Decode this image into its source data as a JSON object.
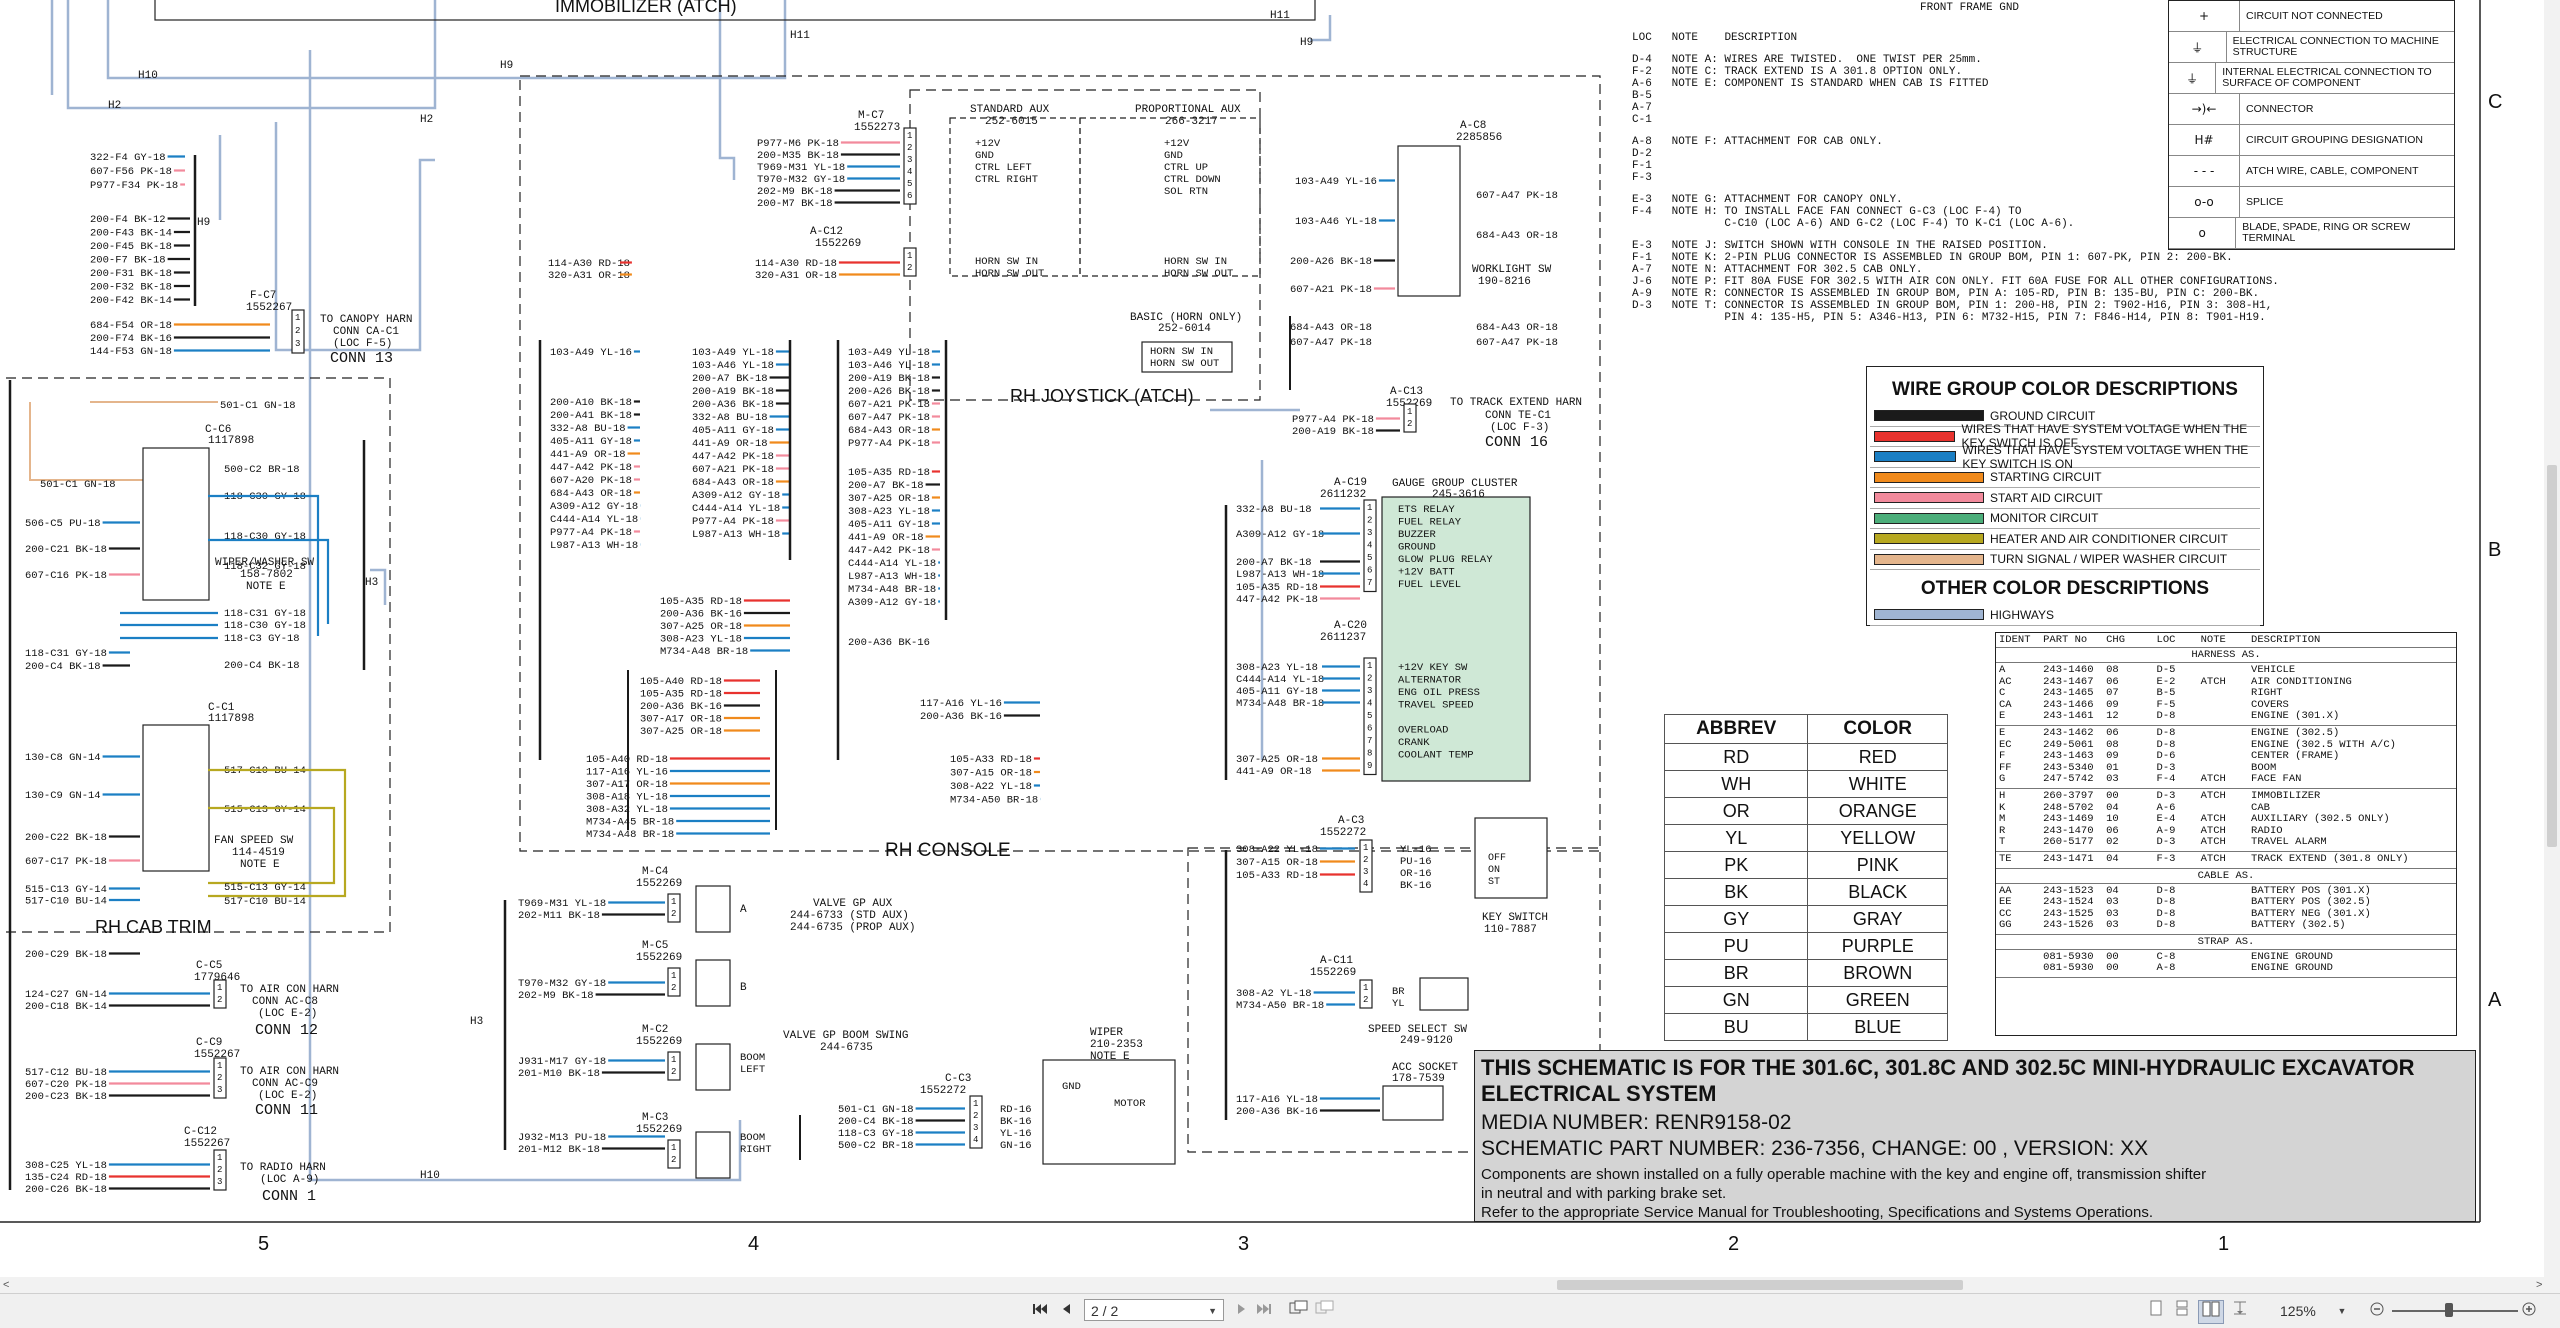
{
  "schematic": {
    "blocks": {
      "immobilizer": "IMMOBILIZER (ATCH)",
      "rh_console": "RH CONSOLE",
      "rh_cab_trim": "RH CAB TRIM",
      "rh_joystick": "RH JOYSTICK (ATCH)",
      "gauge_cluster": "GAUGE GROUP CLUSTER",
      "gauge_cluster_part": "245-3616",
      "front_frame_gnd": "FRONT FRAME GND"
    },
    "connectors": {
      "mc7": "M-C7",
      "mc7_part": "1552273",
      "ac12": "A-C12",
      "ac12_part": "1552269",
      "ac8": "A-C8",
      "ac8_part": "2285856",
      "ac13": "A-C13",
      "ac13_part": "1552269",
      "ac19": "A-C19",
      "ac19_part": "2611232",
      "ac20": "A-C20",
      "ac20_part": "2611237",
      "ac3": "A-C3",
      "ac3_part": "1552272",
      "ac11": "A-C11",
      "ac11_part": "1552269",
      "cc6": "C-C6",
      "cc6_part": "1117898",
      "cc1": "C-C1",
      "cc1_part": "1117898",
      "fc7": "F-C7",
      "fc7_part": "1552267",
      "mc4": "M-C4",
      "mc4_part": "1552269",
      "mc5": "M-C5",
      "mc5_part": "1552269",
      "mc2": "M-C2",
      "mc2_part": "1552269",
      "mc3": "M-C3",
      "mc3_part": "1552269",
      "cc3": "C-C3",
      "cc3_part": "1552272",
      "cc5": "C-C5",
      "cc5_part": "1779646",
      "cc9": "C-C9",
      "cc9_part": "1552267",
      "cc12": "C-C12",
      "cc12_part": "1552267"
    },
    "component_labels": {
      "std_aux": "STANDARD AUX",
      "std_aux_part": "252-6015",
      "prop_aux": "PROPORTIONAL AUX",
      "prop_aux_part": "266-3217",
      "basic_horn": "BASIC (HORN ONLY)",
      "basic_horn_part": "252-6014",
      "worklight_sw": "WORKLIGHT SW",
      "worklight_sw_part": "190-8216",
      "wiper_sw": "WIPER/WASHER SW",
      "wiper_sw_part": "158-7802",
      "wiper_sw_note": "NOTE E",
      "fan_sw": "FAN SPEED SW",
      "fan_sw_part": "114-4519",
      "fan_sw_note": "NOTE E",
      "key_sw": "KEY SWITCH",
      "key_sw_part": "110-7887",
      "speed_sw": "SPEED SELECT SW",
      "speed_sw_part": "249-9120",
      "acc_socket": "ACC SOCKET",
      "acc_socket_part": "178-7539",
      "valve_aux": "VALVE GP AUX",
      "valve_aux_p1": "244-6733 (STD AUX)",
      "valve_aux_p2": "244-6735 (PROP AUX)",
      "valve_boom": "VALVE GP BOOM SWING",
      "valve_boom_part": "244-6735",
      "wiper": "WIPER",
      "wiper_part": "210-2353",
      "wiper_note": "NOTE E",
      "motor": "MOTOR",
      "gnd": "GND",
      "boom_left": "BOOM LEFT",
      "boom_right": "BOOM RIGHT",
      "canopy_harn": "TO CANOPY HARN",
      "canopy_harn2": "CONN CA-C1",
      "canopy_harn3": "(LOC F-5)",
      "canopy_conn": "CONN 13",
      "track_harn": "TO TRACK EXTEND HARN",
      "track_harn2": "CONN TE-C1",
      "track_harn3": "(LOC F-3)",
      "track_conn": "CONN 16",
      "aircon_harn": "TO AIR CON HARN",
      "aircon_harn2": "CONN AC-C8",
      "aircon_harn3": "(LOC E-2)",
      "aircon_conn": "CONN 12",
      "aircon2_harn2": "CONN AC-C9",
      "aircon2_conn": "CONN 11",
      "radio_harn": "TO RADIO HARN",
      "radio_harn2": "(LOC A-9)",
      "radio_conn": "CONN 1"
    },
    "switch_pins": {
      "std_aux": [
        "+12V",
        "GND",
        "CTRL LEFT",
        "CTRL RIGHT"
      ],
      "prop_aux": [
        "+12V",
        "GND",
        "CTRL UP",
        "CTRL DOWN",
        "SOL RTN"
      ],
      "horn": [
        "HORN SW IN",
        "HORN SW OUT"
      ],
      "gauge_19": [
        "ETS RELAY",
        "FUEL RELAY",
        "BUZZER",
        "GROUND",
        "GLOW PLUG RELAY",
        "+12V BATT",
        "FUEL LEVEL"
      ],
      "gauge_20": [
        "+12V KEY SW",
        "ALTERNATOR",
        "ENG OIL PRESS",
        "TRAVEL SPEED",
        "",
        "OVERLOAD",
        "CRANK",
        "COOLANT TEMP"
      ],
      "key": [
        "OFF",
        "ON",
        "ST"
      ]
    },
    "wires": {
      "mc7": [
        "P977-M6 PK-18",
        "200-M35 BK-18",
        "T969-M31 YL-18",
        "T970-M32 GY-18",
        "202-M9 BK-18",
        "200-M7 BK-18"
      ],
      "ac12": [
        "114-A30 RD-18",
        "320-A31 OR-18"
      ],
      "ac8": [
        "103-A49 YL-16",
        "103-A46 YL-18",
        "200-A26 BK-18",
        "607-A21 PK-18",
        "684-A43 OR-18",
        "607-A47 PK-18"
      ],
      "ac13": [
        "P977-A4 PK-18",
        "200-A19 BK-18"
      ],
      "ac19": [
        "332-A8 BU-18",
        "A309-A12 GY-18",
        "200-A7 BK-18",
        "L987-A13 WH-18",
        "105-A35 RD-18",
        "447-A42 PK-18"
      ],
      "ac20": [
        "308-A23 YL-18",
        "C444-A14 YL-18",
        "405-A11 GY-18",
        "M734-A48 BR-18",
        "307-A25 OR-18",
        "441-A9 OR-18"
      ],
      "ac3": [
        "308-A22 YL-18",
        "307-A15 OR-18",
        "105-A33 RD-18"
      ],
      "ac11": [
        "308-A2 YL-18",
        "M734-A50 BR-18"
      ],
      "acc": [
        "117-A16 YL-18",
        "200-A36 BK-16"
      ],
      "cc6": [
        "501-C1 GN-18",
        "500-C2 BR-18",
        "118-C30 GY-18",
        "118-C32 GY-18"
      ],
      "cc1": [
        "517-C10 BU-14",
        "515-C13 GY-14"
      ],
      "cc3": [
        "501-C1 GN-18",
        "200-C4 BK-18",
        "118-C3 GY-18",
        "500-C2 BR-18"
      ],
      "left": [
        "322-F4 GY-18",
        "607-F56 PK-18",
        "P977-F34 PK-18",
        "200-F4 BK-12",
        "200-F43 BK-14",
        "200-F45 BK-18",
        "200-F7 BK-18",
        "200-F31 BK-18",
        "200-F32 BK-18",
        "200-F42 BK-14",
        "684-F54 OR-18",
        "200-F74 BK-16",
        "144-F53 GN-18",
        "506-C5 PU-18",
        "200-C21 BK-18",
        "607-C16 PK-18",
        "118-C31 GY-18",
        "200-C4 BK-18",
        "130-C8 GN-14",
        "130-C9 GN-14",
        "200-C22 BK-18",
        "607-C17 PK-18",
        "515-C13 GY-14",
        "517-C10 BU-14",
        "200-C29 BK-18",
        "124-C27 GN-14",
        "200-C18 BK-14",
        "517-C12 BU-18",
        "607-C20 PK-18",
        "200-C23 BK-18",
        "308-C25 YL-18",
        "135-C24 RD-18",
        "200-C26 BK-18"
      ],
      "valves": [
        "T969-M31 YL-18",
        "202-M11 BK-18",
        "T970-M32 GY-18",
        "202-M9 BK-18",
        "J931-M17 GY-18",
        "201-M10 BK-18",
        "J932-M13 PU-18",
        "201-M12 BK-18"
      ],
      "console_a": [
        "103-A49 YL-16",
        "200-A10 BK-18",
        "200-A41 BK-18",
        "332-A8 BU-18",
        "405-A11 GY-18",
        "441-A9 OR-18",
        "447-A42 PK-18",
        "607-A20 PK-18",
        "684-A43 OR-18",
        "A309-A12 GY-18",
        "C444-A14 YL-18",
        "P977-A4 PK-18",
        "L987-A13 WH-18"
      ],
      "console_b": [
        "103-A49 YL-18",
        "103-A46 YL-18",
        "200-A7 BK-18",
        "200-A19 BK-18",
        "200-A36 BK-18",
        "332-A8 BU-18",
        "405-A11 GY-18",
        "441-A9 OR-18",
        "447-A42 PK-18",
        "607-A21 PK-18",
        "684-A43 OR-18",
        "A309-A12 GY-18",
        "C444-A14 YL-18",
        "P977-A4 PK-18",
        "L987-A13 WH-18"
      ],
      "console_c": [
        "103-A49 YL-18",
        "103-A46 YL-18",
        "200-A19 BK-18",
        "200-A26 BK-18",
        "607-A21 PK-18",
        "607-A47 PK-18",
        "684-A43 OR-18",
        "P977-A4 PK-18",
        "105-A35 RD-18",
        "200-A7 BK-18",
        "307-A25 OR-18",
        "308-A23 YL-18",
        "405-A11 GY-18",
        "441-A9 OR-18",
        "447-A42 PK-18",
        "C444-A14 YL-18",
        "L987-A13 WH-18",
        "M734-A48 BR-18",
        "A309-A12 GY-18",
        "200-A36 BK-16"
      ],
      "console_d": [
        "105-A35 RD-18",
        "200-A36 BK-16",
        "307-A25 OR-18",
        "308-A23 YL-18",
        "M734-A48 BR-18",
        "105-A40 RD-18",
        "105-A35 RD-18",
        "200-A36 BK-16",
        "307-A17 OR-18",
        "307-A25 OR-18",
        "117-A16 YL-16",
        "200-A36 BK-16",
        "105-A33 RD-18",
        "307-A15 OR-18",
        "308-A22 YL-18",
        "M734-A50 BR-18"
      ],
      "console_e": [
        "105-A40 RD-18",
        "117-A16 YL-16",
        "307-A17 OR-18",
        "308-A18 YL-18",
        "308-A32 YL-18",
        "M734-A45 BR-18",
        "M734-A48 BR-18"
      ],
      "keysw": [
        "YL-16",
        "PU-16",
        "OR-16",
        "BK-16"
      ],
      "speedsw": [
        "BR",
        "YL"
      ],
      "wiper": [
        "RD-16",
        "BK-16",
        "YL-16",
        "GN-16"
      ]
    },
    "circuit_tags": [
      "H11",
      "H10",
      "H9",
      "H2",
      "H3",
      "H11",
      "H9",
      "H2",
      "H3",
      "H10"
    ],
    "column_numbers": [
      "5",
      "4",
      "3",
      "2",
      "1"
    ],
    "row_letters": [
      "C",
      "B",
      "A"
    ]
  },
  "legend": [
    {
      "symbol": "+",
      "text": "CIRCUIT NOT CONNECTED"
    },
    {
      "symbol": "⏚",
      "text": "ELECTRICAL CONNECTION TO MACHINE STRUCTURE"
    },
    {
      "symbol": "⏚",
      "text": "INTERNAL ELECTRICAL CONNECTION TO SURFACE OF COMPONENT"
    },
    {
      "symbol": "→)←",
      "text": "CONNECTOR"
    },
    {
      "symbol": "H#",
      "text": "CIRCUIT GROUPING DESIGNATION"
    },
    {
      "symbol": "- - -",
      "text": "ATCH WIRE, CABLE, COMPONENT"
    },
    {
      "symbol": "o-o",
      "text": "SPLICE"
    },
    {
      "symbol": "o",
      "text": "BLADE, SPADE, RING OR SCREW TERMINAL"
    }
  ],
  "notes": {
    "headers": [
      "LOC",
      "NOTE",
      "DESCRIPTION"
    ],
    "rows": [
      {
        "loc": [
          "D-4",
          "F-2",
          "A-6",
          "B-5",
          "A-7",
          "C-1"
        ],
        "lines": [
          "NOTE A: WIRES ARE TWISTED.  ONE TWIST PER 25mm.",
          "NOTE C: TRACK EXTEND IS A 301.8 OPTION ONLY.",
          "NOTE E: COMPONENT IS STANDARD WHEN CAB IS FITTED"
        ]
      },
      {
        "loc": [
          "A-8",
          "D-2",
          "F-1",
          "F-3"
        ],
        "lines": [
          "NOTE F: ATTACHMENT FOR CAB ONLY."
        ]
      },
      {
        "loc": [
          "E-3",
          "F-4"
        ],
        "lines": [
          "NOTE G: ATTACHMENT FOR CANOPY ONLY.",
          "NOTE H: TO INSTALL FACE FAN CONNECT G-C3 (LOC F-4) TO",
          "        C-C10 (LOC A-6) AND G-C2 (LOC F-4) TO K-C1 (LOC A-6)."
        ]
      },
      {
        "loc": [
          "E-3",
          "F-1",
          "A-7",
          "J-6",
          "A-9",
          "D-3"
        ],
        "lines": [
          "NOTE J: SWITCH SHOWN WITH CONSOLE IN THE RAISED POSITION.",
          "NOTE K: 2-PIN PLUG CONNECTOR IS ASSEMBLED IN GROUP BOM, PIN 1: 607-PK, PIN 2: 200-BK.",
          "NOTE N: ATTACHMENT FOR 302.5 CAB ONLY.",
          "NOTE P: FIT 80A FUSE FOR 302.5 WITH AIR CON ONLY. FIT 60A FUSE FOR ALL OTHER CONFIGURATIONS.",
          "NOTE R: CONNECTOR IS ASSEMBLED IN GROUP BOM, PIN A: 105-RD, PIN B: 135-BU, PIN C: 200-BK.",
          "NOTE T: CONNECTOR IS ASSEMBLED IN GROUP BOM, PIN 1: 200-H8, PIN 2: T902-H16, PIN 3: 308-H1,",
          "        PIN 4: 135-H5, PIN 5: A346-H13, PIN 6: M732-H15, PIN 7: F846-H14, PIN 8: T901-H19."
        ]
      }
    ]
  },
  "wire_groups": {
    "title": "WIRE GROUP COLOR DESCRIPTIONS",
    "items": [
      {
        "color": "#1a1a1a",
        "label": "GROUND CIRCUIT"
      },
      {
        "color": "#e8322e",
        "label": "WIRES THAT HAVE SYSTEM VOLTAGE WHEN THE KEY SWITCH IS OFF"
      },
      {
        "color": "#1b7fc4",
        "label": "WIRES THAT HAVE SYSTEM VOLTAGE WHEN THE KEY SWITCH IS ON"
      },
      {
        "color": "#f08a1c",
        "label": "STARTING CIRCUIT"
      },
      {
        "color": "#f28a9c",
        "label": "START AID CIRCUIT"
      },
      {
        "color": "#4cae7a",
        "label": "MONITOR CIRCUIT"
      },
      {
        "color": "#b7a820",
        "label": "HEATER AND AIR CONDITIONER CIRCUIT"
      },
      {
        "color": "#e4b58c",
        "label": "TURN SIGNAL / WIPER WASHER CIRCUIT"
      }
    ],
    "other_title": "OTHER COLOR DESCRIPTIONS",
    "other": [
      {
        "color": "#9fb4d2",
        "label": "HIGHWAYS"
      }
    ]
  },
  "abbrev": {
    "headers": [
      "ABBREV",
      "COLOR"
    ],
    "rows": [
      [
        "RD",
        "RED"
      ],
      [
        "WH",
        "WHITE"
      ],
      [
        "OR",
        "ORANGE"
      ],
      [
        "YL",
        "YELLOW"
      ],
      [
        "PK",
        "PINK"
      ],
      [
        "BK",
        "BLACK"
      ],
      [
        "GY",
        "GRAY"
      ],
      [
        "PU",
        "PURPLE"
      ],
      [
        "BR",
        "BROWN"
      ],
      [
        "GN",
        "GREEN"
      ],
      [
        "BU",
        "BLUE"
      ]
    ]
  },
  "harness": {
    "header": "IDENT  PART No   CHG     LOC    NOTE    DESCRIPTION",
    "section1": "HARNESS AS.",
    "groups1": [
      [
        "A      243-1460  08      D-5            VEHICLE",
        "AC     243-1467  06      E-2    ATCH    AIR CONDITIONING",
        "C      243-1465  07      B-5            RIGHT",
        "CA     243-1466  09      F-5            COVERS",
        "E      243-1461  12      D-8            ENGINE (301.X)"
      ],
      [
        "E      243-1462  06      D-8            ENGINE (302.5)",
        "EC     249-5061  08      D-8            ENGINE (302.5 WITH A/C)",
        "F      243-1463  09      D-6            CENTER (FRAME)",
        "FF     243-5340  01      D-3            BOOM",
        "G      247-5742  03      F-4    ATCH    FACE FAN"
      ],
      [
        "H      260-3797  00      D-3    ATCH    IMMOBILIZER",
        "K      248-5702  04      A-6            CAB",
        "M      243-1469  10      E-4    ATCH    AUXILIARY (302.5 ONLY)",
        "R      243-1470  06      A-9    ATCH    RADIO",
        "T      260-5177  02      D-3    ATCH    TRAVEL ALARM"
      ],
      [
        "TE     243-1471  04      F-3    ATCH    TRACK EXTEND (301.8 ONLY)"
      ]
    ],
    "section2": "CABLE AS.",
    "groups2": [
      [
        "AA     243-1523  04      D-8            BATTERY POS (301.X)",
        "EE     243-1524  03      D-8            BATTERY POS (302.5)",
        "CC     243-1525  03      D-8            BATTERY NEG (301.X)",
        "GG     243-1526  03      D-8            BATTERY (302.5)"
      ]
    ],
    "section3": "STRAP AS.",
    "groups3": [
      [
        "       081-5930  00      C-8            ENGINE GROUND",
        "       081-5930  00      A-8            ENGINE GROUND"
      ]
    ]
  },
  "title_block": {
    "line1": "THIS SCHEMATIC IS FOR THE  301.6C,  301.8C AND 302.5C MINI-HYDRAULIC EXCAVATOR",
    "line2": "ELECTRICAL SYSTEM",
    "media": "MEDIA NUMBER: RENR9158-02",
    "part": "SCHEMATIC PART NUMBER: 236-7356, CHANGE: 00 , VERSION: XX",
    "desc1": "Components are shown installed on a fully operable machine with the key and engine off, transmission shifter",
    "desc2": "in neutral and with parking brake set.",
    "desc3": "Refer to the appropriate Service Manual for Troubleshooting, Specifications and Systems Operations."
  },
  "viewer": {
    "page_field": "2 / 2",
    "zoom": "125%",
    "zoom_level": 0.45,
    "hscroll_pos": 0.73,
    "vscroll_pos": 0.52
  }
}
